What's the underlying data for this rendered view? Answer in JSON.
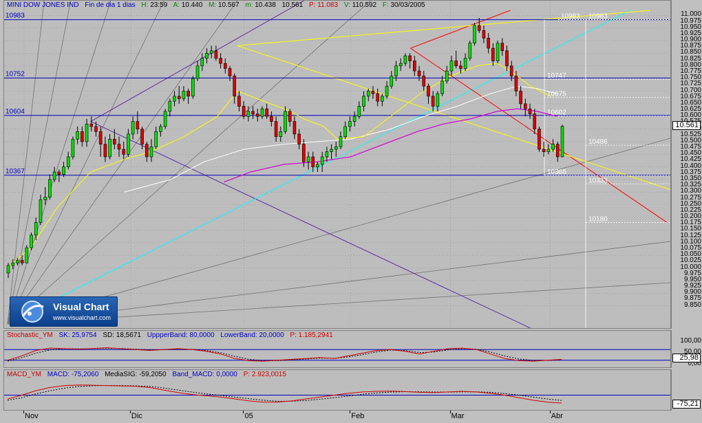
{
  "header": {
    "symbol": "MINI DOW JONES IND",
    "period": "Fin de dia 1 dias",
    "high_label": "H:",
    "high": "23:59",
    "a_label": "A:",
    "a": "10.440",
    "m_label": "M:",
    "m": "10.567",
    "mi_label": "m:",
    "mi": "10.438",
    "c": "10.561",
    "p_label": "P:",
    "p": "11.083",
    "v_label": "V:",
    "v": "110.592",
    "f_label": "F:",
    "f": "30/03/2005"
  },
  "stoch_header": {
    "name": "Stochastic_YM",
    "sk": "SK: 25,9754",
    "sd": "SD: 18,5671",
    "upper": "UppperBand: 80,0000",
    "lower": "LowerBand: 20,0000",
    "p": "P: 1.185,2941"
  },
  "macd_header": {
    "name": "MACD_YM",
    "macd": "MACD: -75,2060",
    "media": "MediaSIG: -59,2050",
    "band": "Band_MACD: 0,0000",
    "p": "P: 2.923,0015"
  },
  "logo": {
    "title": "Visual Chart",
    "url": "www.visualchart.com"
  },
  "colors": {
    "up": "#00e000",
    "down": "#e00000",
    "hline": "#0000c0",
    "yellow": "#ffff00",
    "cyan": "#00ffff",
    "magenta": "#d000d0",
    "white": "#ffffff",
    "red": "#ff0000",
    "purple": "#5a2ca0"
  },
  "chart_data": {
    "type": "candlestick",
    "ylim": [
      9800,
      11020
    ],
    "y_ticks": [
      "11.000",
      "10.975",
      "10.950",
      "10.925",
      "10.900",
      "10.875",
      "10.850",
      "10.825",
      "10.800",
      "10.775",
      "10.750",
      "10.725",
      "10.700",
      "10.675",
      "10.650",
      "10.625",
      "10.600",
      "10.575",
      "10.550",
      "10.525",
      "10.500",
      "10.475",
      "10.450",
      "10.425",
      "10.400",
      "10.375",
      "10.350",
      "10.325",
      "10.300",
      "10.275",
      "10.250",
      "10.225",
      "10.200",
      "10.175",
      "10.150",
      "10.125",
      "10.100",
      "10.075",
      "10.050",
      "10.025",
      "10.000",
      "9.975",
      "9.950",
      "9.925",
      "9.900",
      "9.875",
      "9.850"
    ],
    "current_value": "10.561",
    "x_labels": [
      "Nov",
      "Dic",
      "05",
      "Feb",
      "Mar",
      "Abr"
    ],
    "h_levels": [
      {
        "value": 10983,
        "label": "10983"
      },
      {
        "value": 10752,
        "label": "10752"
      },
      {
        "value": 10604,
        "label": "10604"
      },
      {
        "value": 10367,
        "label": "10367"
      }
    ],
    "right_levels": [
      {
        "value": 10983,
        "label": "10983"
      },
      {
        "value": 10983,
        "label": "10983"
      },
      {
        "value": 10747,
        "label": "10747"
      },
      {
        "value": 10675,
        "label": "10675"
      },
      {
        "value": 10602,
        "label": "10602"
      },
      {
        "value": 10486,
        "label": "10486"
      },
      {
        "value": 10366,
        "label": "10366"
      },
      {
        "value": 10333,
        "label": "10333"
      },
      {
        "value": 10180,
        "label": "10180"
      }
    ],
    "candles": [
      [
        9980,
        10020,
        9960,
        10010
      ],
      [
        10010,
        10035,
        9995,
        10020
      ],
      [
        10020,
        10040,
        10010,
        10030
      ],
      [
        10030,
        10050,
        10010,
        10020
      ],
      [
        10020,
        10090,
        10020,
        10080
      ],
      [
        10080,
        10140,
        10070,
        10130
      ],
      [
        10130,
        10200,
        10110,
        10180
      ],
      [
        10180,
        10290,
        10170,
        10270
      ],
      [
        10270,
        10320,
        10250,
        10280
      ],
      [
        10280,
        10370,
        10270,
        10350
      ],
      [
        10350,
        10400,
        10340,
        10380
      ],
      [
        10380,
        10390,
        10340,
        10370
      ],
      [
        10370,
        10420,
        10360,
        10400
      ],
      [
        10400,
        10460,
        10390,
        10440
      ],
      [
        10440,
        10520,
        10430,
        10510
      ],
      [
        10510,
        10560,
        10490,
        10540
      ],
      [
        10540,
        10560,
        10480,
        10500
      ],
      [
        10500,
        10590,
        10480,
        10570
      ],
      [
        10570,
        10600,
        10540,
        10560
      ],
      [
        10560,
        10580,
        10520,
        10540
      ],
      [
        10540,
        10560,
        10440,
        10490
      ],
      [
        10490,
        10520,
        10420,
        10440
      ],
      [
        10440,
        10530,
        10430,
        10510
      ],
      [
        10510,
        10550,
        10470,
        10490
      ],
      [
        10490,
        10520,
        10440,
        10470
      ],
      [
        10470,
        10500,
        10430,
        10450
      ],
      [
        10450,
        10550,
        10440,
        10530
      ],
      [
        10530,
        10600,
        10510,
        10580
      ],
      [
        10580,
        10620,
        10530,
        10550
      ],
      [
        10550,
        10560,
        10470,
        10490
      ],
      [
        10490,
        10500,
        10420,
        10440
      ],
      [
        10440,
        10510,
        10420,
        10480
      ],
      [
        10480,
        10560,
        10470,
        10540
      ],
      [
        10540,
        10570,
        10520,
        10560
      ],
      [
        10560,
        10630,
        10550,
        10620
      ],
      [
        10620,
        10670,
        10600,
        10660
      ],
      [
        10660,
        10700,
        10640,
        10680
      ],
      [
        10680,
        10720,
        10650,
        10670
      ],
      [
        10670,
        10720,
        10660,
        10700
      ],
      [
        10700,
        10710,
        10650,
        10680
      ],
      [
        10680,
        10760,
        10670,
        10750
      ],
      [
        10750,
        10820,
        10740,
        10800
      ],
      [
        10800,
        10850,
        10780,
        10830
      ],
      [
        10830,
        10870,
        10810,
        10850
      ],
      [
        10850,
        10880,
        10830,
        10860
      ],
      [
        10860,
        10880,
        10820,
        10830
      ],
      [
        10830,
        10850,
        10790,
        10810
      ],
      [
        10810,
        10830,
        10770,
        10790
      ],
      [
        10790,
        10800,
        10740,
        10760
      ],
      [
        10760,
        10770,
        10650,
        10680
      ],
      [
        10680,
        10700,
        10620,
        10640
      ],
      [
        10640,
        10660,
        10590,
        10600
      ],
      [
        10600,
        10640,
        10580,
        10620
      ],
      [
        10620,
        10640,
        10590,
        10610
      ],
      [
        10610,
        10630,
        10580,
        10600
      ],
      [
        10600,
        10640,
        10590,
        10630
      ],
      [
        10630,
        10650,
        10590,
        10600
      ],
      [
        10600,
        10620,
        10560,
        10580
      ],
      [
        10580,
        10600,
        10500,
        10520
      ],
      [
        10520,
        10560,
        10500,
        10540
      ],
      [
        10540,
        10640,
        10530,
        10620
      ],
      [
        10620,
        10630,
        10560,
        10580
      ],
      [
        10580,
        10600,
        10510,
        10530
      ],
      [
        10530,
        10550,
        10470,
        10490
      ],
      [
        10490,
        10510,
        10400,
        10420
      ],
      [
        10420,
        10460,
        10390,
        10440
      ],
      [
        10440,
        10460,
        10380,
        10400
      ],
      [
        10400,
        10420,
        10380,
        10410
      ],
      [
        10410,
        10460,
        10380,
        10440
      ],
      [
        10440,
        10480,
        10420,
        10460
      ],
      [
        10460,
        10490,
        10430,
        10470
      ],
      [
        10470,
        10500,
        10440,
        10480
      ],
      [
        10480,
        10540,
        10470,
        10520
      ],
      [
        10520,
        10580,
        10510,
        10560
      ],
      [
        10560,
        10600,
        10540,
        10580
      ],
      [
        10580,
        10620,
        10560,
        10600
      ],
      [
        10600,
        10660,
        10590,
        10640
      ],
      [
        10640,
        10700,
        10620,
        10680
      ],
      [
        10680,
        10710,
        10660,
        10700
      ],
      [
        10700,
        10720,
        10670,
        10690
      ],
      [
        10690,
        10710,
        10640,
        10660
      ],
      [
        10660,
        10690,
        10640,
        10680
      ],
      [
        10680,
        10740,
        10670,
        10720
      ],
      [
        10720,
        10780,
        10710,
        10760
      ],
      [
        10760,
        10820,
        10740,
        10800
      ],
      [
        10800,
        10830,
        10780,
        10810
      ],
      [
        10810,
        10850,
        10800,
        10840
      ],
      [
        10840,
        10850,
        10790,
        10820
      ],
      [
        10820,
        10840,
        10760,
        10780
      ],
      [
        10780,
        10800,
        10740,
        10760
      ],
      [
        10760,
        10780,
        10700,
        10720
      ],
      [
        10720,
        10730,
        10650,
        10680
      ],
      [
        10680,
        10700,
        10620,
        10640
      ],
      [
        10640,
        10700,
        10620,
        10690
      ],
      [
        10690,
        10760,
        10680,
        10740
      ],
      [
        10740,
        10800,
        10730,
        10780
      ],
      [
        10780,
        10840,
        10760,
        10820
      ],
      [
        10820,
        10860,
        10790,
        10800
      ],
      [
        10800,
        10820,
        10770,
        10790
      ],
      [
        10790,
        10850,
        10780,
        10830
      ],
      [
        10830,
        10900,
        10820,
        10890
      ],
      [
        10890,
        10970,
        10880,
        10960
      ],
      [
        10960,
        10990,
        10930,
        10940
      ],
      [
        10940,
        10960,
        10890,
        10910
      ],
      [
        10910,
        10930,
        10850,
        10870
      ],
      [
        10870,
        10890,
        10800,
        10820
      ],
      [
        10820,
        10900,
        10810,
        10890
      ],
      [
        10890,
        10910,
        10840,
        10860
      ],
      [
        10860,
        10880,
        10780,
        10800
      ],
      [
        10800,
        10820,
        10740,
        10760
      ],
      [
        10760,
        10780,
        10680,
        10700
      ],
      [
        10700,
        10720,
        10630,
        10650
      ],
      [
        10650,
        10670,
        10600,
        10630
      ],
      [
        10630,
        10650,
        10590,
        10610
      ],
      [
        10610,
        10630,
        10530,
        10550
      ],
      [
        10550,
        10560,
        10460,
        10470
      ],
      [
        10470,
        10500,
        10440,
        10460
      ],
      [
        10460,
        10490,
        10450,
        10470
      ],
      [
        10470,
        10510,
        10460,
        10490
      ],
      [
        10490,
        10500,
        10420,
        10440
      ],
      [
        10440,
        10567,
        10438,
        10561
      ]
    ],
    "ma_white": [
      [
        0.18,
        10300
      ],
      [
        0.25,
        10350
      ],
      [
        0.3,
        10420
      ],
      [
        0.36,
        10470
      ],
      [
        0.42,
        10490
      ],
      [
        0.47,
        10500
      ],
      [
        0.52,
        10510
      ],
      [
        0.58,
        10550
      ],
      [
        0.63,
        10600
      ],
      [
        0.68,
        10640
      ],
      [
        0.73,
        10690
      ],
      [
        0.77,
        10720
      ],
      [
        0.8,
        10710
      ],
      [
        0.83,
        10690
      ]
    ],
    "ma_yellow_fast": [
      [
        0.005,
        10000
      ],
      [
        0.04,
        10080
      ],
      [
        0.08,
        10240
      ],
      [
        0.13,
        10380
      ],
      [
        0.18,
        10430
      ],
      [
        0.22,
        10460
      ],
      [
        0.27,
        10520
      ],
      [
        0.32,
        10600
      ],
      [
        0.35,
        10700
      ],
      [
        0.37,
        10680
      ],
      [
        0.4,
        10650
      ],
      [
        0.43,
        10620
      ],
      [
        0.45,
        10590
      ],
      [
        0.48,
        10560
      ],
      [
        0.5,
        10510
      ],
      [
        0.54,
        10520
      ],
      [
        0.57,
        10580
      ],
      [
        0.6,
        10640
      ],
      [
        0.63,
        10700
      ],
      [
        0.67,
        10760
      ],
      [
        0.71,
        10800
      ],
      [
        0.74,
        10810
      ],
      [
        0.76,
        10780
      ],
      [
        0.79,
        10720
      ],
      [
        0.82,
        10680
      ]
    ],
    "ma_magenta": [
      [
        0.33,
        10340
      ],
      [
        0.37,
        10380
      ],
      [
        0.42,
        10410
      ],
      [
        0.47,
        10420
      ],
      [
        0.52,
        10440
      ],
      [
        0.57,
        10490
      ],
      [
        0.62,
        10540
      ],
      [
        0.66,
        10570
      ],
      [
        0.7,
        10590
      ],
      [
        0.74,
        10620
      ],
      [
        0.77,
        10630
      ],
      [
        0.8,
        10620
      ],
      [
        0.83,
        10600
      ]
    ],
    "stoch_sk": [
      0.2,
      0.45,
      0.75,
      0.88,
      0.85,
      0.82,
      0.86,
      0.9,
      0.85,
      0.8,
      0.75,
      0.8,
      0.85,
      0.8,
      0.7,
      0.55,
      0.3,
      0.18,
      0.15,
      0.2,
      0.25,
      0.3,
      0.35,
      0.3,
      0.45,
      0.6,
      0.75,
      0.8,
      0.7,
      0.55,
      0.7,
      0.85,
      0.88,
      0.8,
      0.55,
      0.3,
      0.18,
      0.15,
      0.2,
      0.25
    ],
    "stoch_sd": [
      0.15,
      0.35,
      0.6,
      0.78,
      0.85,
      0.84,
      0.85,
      0.87,
      0.86,
      0.82,
      0.78,
      0.79,
      0.82,
      0.81,
      0.74,
      0.62,
      0.42,
      0.25,
      0.18,
      0.18,
      0.22,
      0.27,
      0.32,
      0.31,
      0.39,
      0.52,
      0.67,
      0.77,
      0.74,
      0.63,
      0.66,
      0.78,
      0.85,
      0.82,
      0.66,
      0.44,
      0.27,
      0.19,
      0.19,
      0.22
    ],
    "macd_line": [
      -0.3,
      0.0,
      0.35,
      0.6,
      0.75,
      0.8,
      0.78,
      0.75,
      0.72,
      0.7,
      0.6,
      0.4,
      0.2,
      0.05,
      -0.05,
      -0.15,
      -0.3,
      -0.45,
      -0.55,
      -0.55,
      -0.45,
      -0.3,
      -0.15,
      0.0,
      0.15,
      0.25,
      0.3,
      0.32,
      0.28,
      0.22,
      0.2,
      0.25,
      0.3,
      0.25,
      0.15,
      0.0,
      -0.2,
      -0.4,
      -0.55,
      -0.62
    ],
    "macd_signal": [
      -0.4,
      -0.2,
      0.1,
      0.35,
      0.55,
      0.68,
      0.74,
      0.76,
      0.75,
      0.73,
      0.68,
      0.56,
      0.4,
      0.24,
      0.1,
      -0.02,
      -0.15,
      -0.28,
      -0.4,
      -0.48,
      -0.48,
      -0.42,
      -0.32,
      -0.2,
      -0.07,
      0.07,
      0.17,
      0.24,
      0.27,
      0.26,
      0.24,
      0.24,
      0.26,
      0.26,
      0.22,
      0.13,
      0.0,
      -0.15,
      -0.3,
      -0.42
    ]
  }
}
